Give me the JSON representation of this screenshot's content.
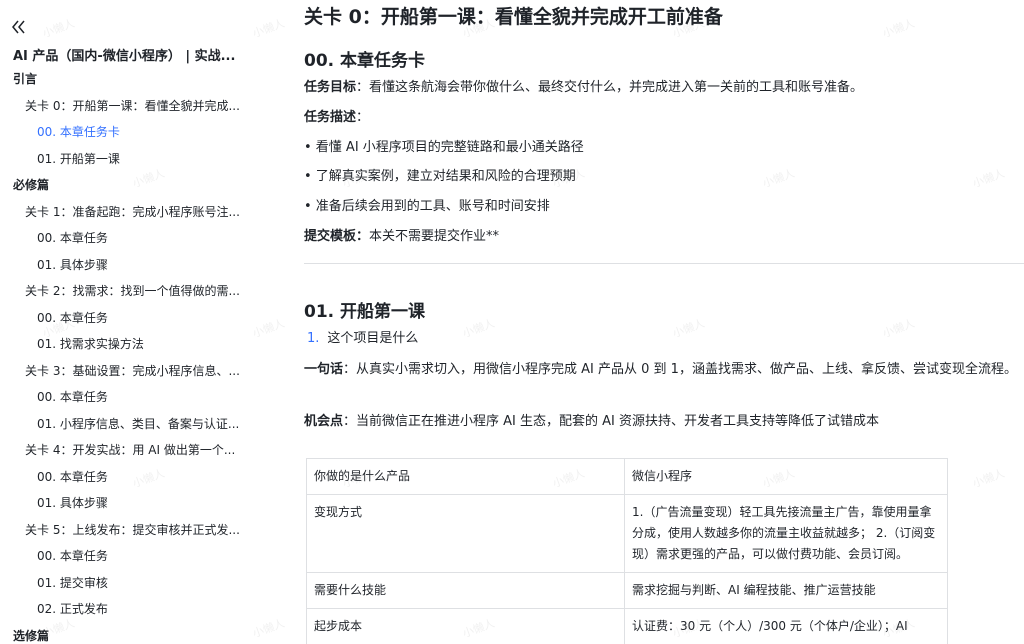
{
  "sidebar": {
    "doc_title": "AI 产品（国内-微信小程序） | 实战...",
    "items": [
      {
        "label": "引言",
        "level": 0
      },
      {
        "label": "关卡 0：开船第一课：看懂全貌并完成...",
        "level": 1
      },
      {
        "label": "00. 本章任务卡",
        "level": 2,
        "active": true
      },
      {
        "label": "01. 开船第一课",
        "level": 2
      },
      {
        "label": "必修篇",
        "level": 0
      },
      {
        "label": "关卡 1：准备起跑：完成小程序账号注...",
        "level": 1
      },
      {
        "label": "00. 本章任务",
        "level": 2
      },
      {
        "label": "01. 具体步骤",
        "level": 2
      },
      {
        "label": "关卡 2：找需求：找到一个值得做的需...",
        "level": 1
      },
      {
        "label": "00. 本章任务",
        "level": 2
      },
      {
        "label": "01. 找需求实操方法",
        "level": 2
      },
      {
        "label": "关卡 3：基础设置：完成小程序信息、...",
        "level": 1
      },
      {
        "label": "00. 本章任务",
        "level": 2
      },
      {
        "label": "01. 小程序信息、类目、备案与认证...",
        "level": 2
      },
      {
        "label": "关卡 4：开发实战：用 AI 做出第一个...",
        "level": 1
      },
      {
        "label": "00. 本章任务",
        "level": 2
      },
      {
        "label": "01. 具体步骤",
        "level": 2
      },
      {
        "label": "关卡 5：上线发布：提交审核并正式发...",
        "level": 1
      },
      {
        "label": "00. 本章任务",
        "level": 2
      },
      {
        "label": "01. 提交审核",
        "level": 2
      },
      {
        "label": "02. 正式发布",
        "level": 2
      },
      {
        "label": "选修篇",
        "level": 0
      }
    ]
  },
  "main": {
    "title": "关卡 0：开船第一课：看懂全貌并完成开工前准备",
    "section1": {
      "heading": "00. 本章任务卡",
      "goal_label": "任务目标",
      "goal_text": "：看懂这条航海会带你做什么、最终交付什么，并完成进入第一关前的工具和账号准备。",
      "desc_label": "任务描述",
      "desc_suffix": "：",
      "bullets": [
        "• 看懂 AI 小程序项目的完整链路和最小通关路径",
        "• 了解真实案例，建立对结果和风险的合理预期",
        "• 准备后续会用到的工具、账号和时间安排"
      ],
      "submit_label": "提交模板：",
      "submit_text": "本关不需要提交作业**"
    },
    "section2": {
      "heading": "01. 开船第一课",
      "numbered_index": "1.",
      "numbered_text": "这个项目是什么",
      "oneline_label": "一句话",
      "oneline_text": "：从真实小需求切入，用微信小程序完成 AI 产品从 0 到 1，涵盖找需求、做产品、上线、拿反馈、尝试变现全流程。",
      "chance_label": "机会点",
      "chance_text": "：当前微信正在推进小程序 AI 生态，配套的 AI 资源扶持、开发者工具支持等降低了试错成本"
    },
    "table": {
      "rows": [
        [
          "你做的是什么产品",
          "微信小程序"
        ],
        [
          "变现方式",
          "1.（广告流量变现）轻工具先接流量主广告，靠使用量拿分成，使用人数越多你的流量主收益就越多； 2.（订阅变现）需求更强的产品，可以做付费功能、会员订阅。"
        ],
        [
          "需要什么技能",
          "需求挖掘与判断、AI 编程技能、推广运营技能"
        ],
        [
          "起步成本",
          "认证费：30 元（个人）/300 元（个体户/企业）；AI"
        ]
      ]
    },
    "watermark_text": "小懒人"
  }
}
